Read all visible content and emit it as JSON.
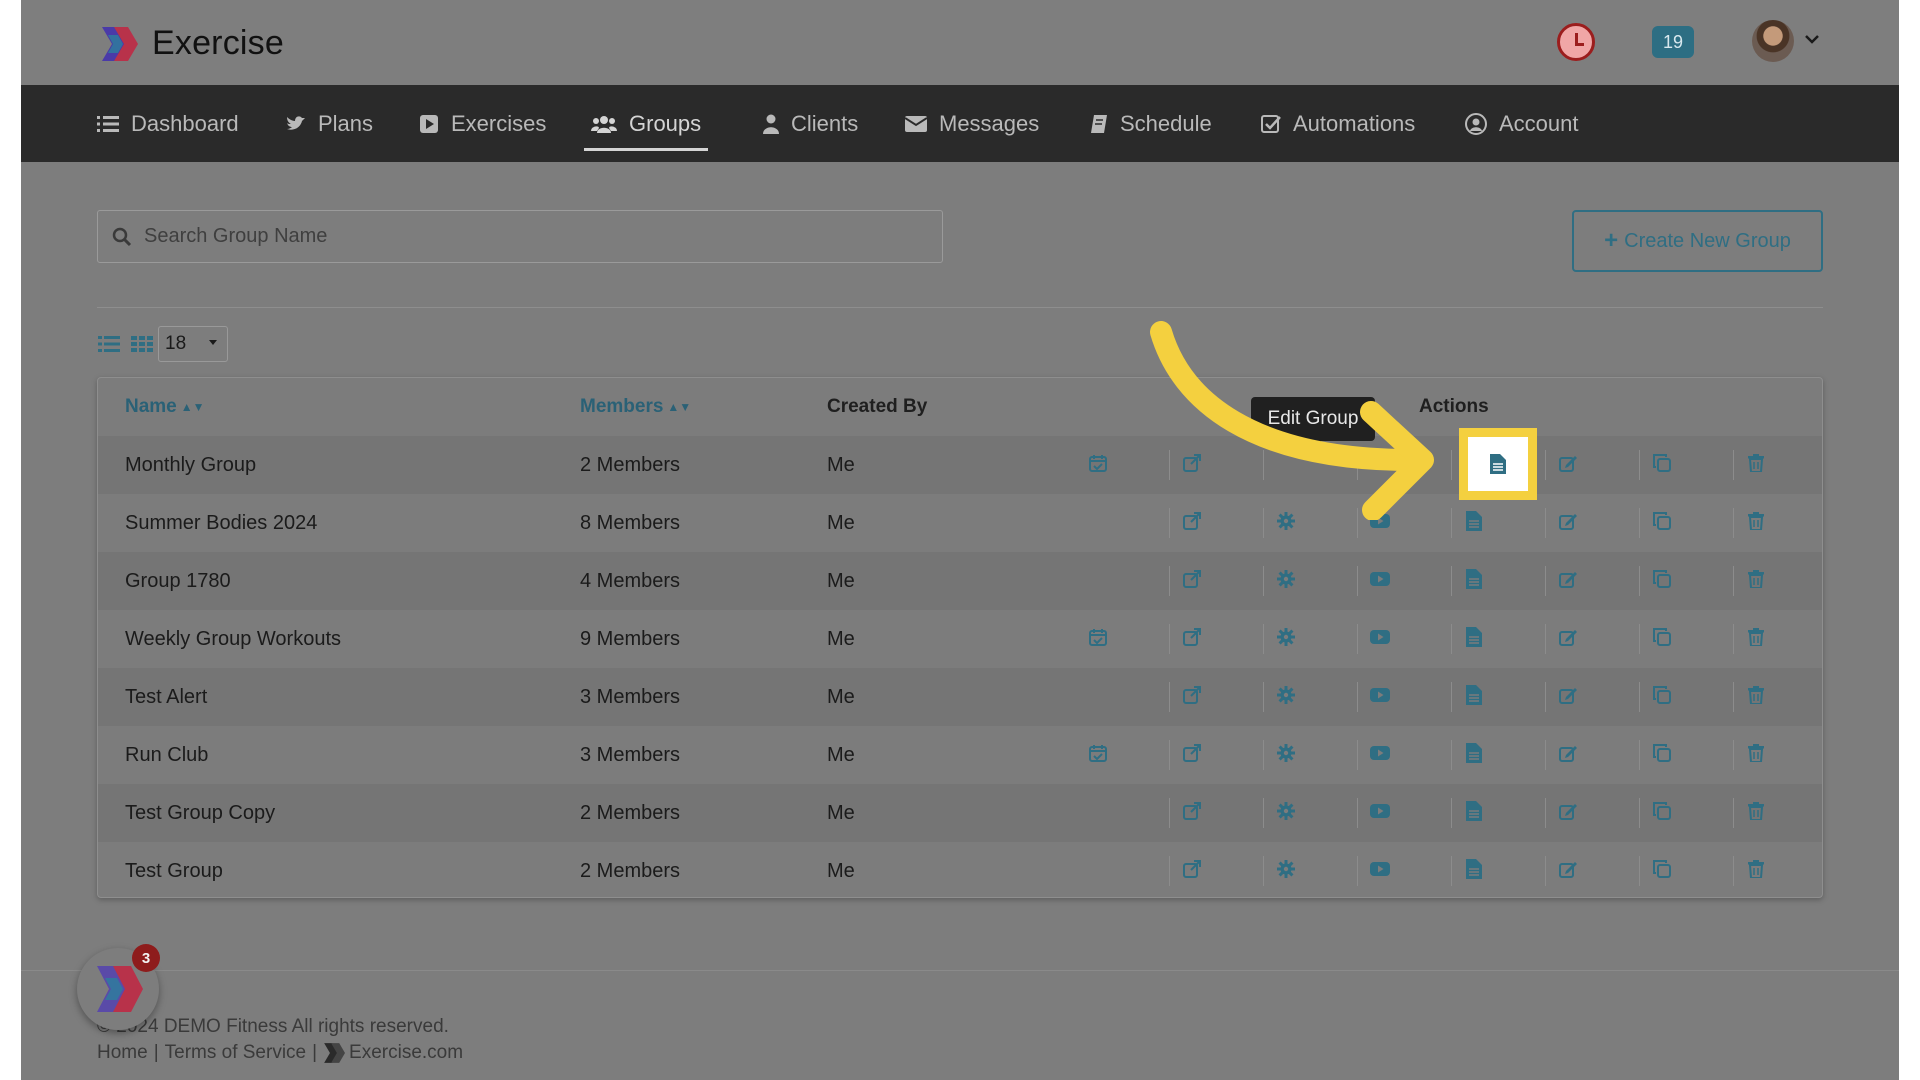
{
  "app": {
    "brand": "Exercise",
    "notification_count": "19"
  },
  "nav": {
    "items": [
      {
        "label": "Dashboard",
        "icon": "list-icon"
      },
      {
        "label": "Plans",
        "icon": "bird-icon"
      },
      {
        "label": "Exercises",
        "icon": "video-icon"
      },
      {
        "label": "Groups",
        "icon": "users-icon",
        "active": true
      },
      {
        "label": "Clients",
        "icon": "user-icon"
      },
      {
        "label": "Messages",
        "icon": "envelope-icon"
      },
      {
        "label": "Schedule",
        "icon": "book-icon"
      },
      {
        "label": "Automations",
        "icon": "check-square-icon"
      },
      {
        "label": "Account",
        "icon": "user-circle-icon"
      }
    ]
  },
  "search": {
    "placeholder": "Search Group Name",
    "value": ""
  },
  "toolbar": {
    "create_label": "Create New Group",
    "per_page": "18"
  },
  "table": {
    "headers": {
      "name": "Name",
      "members": "Members",
      "created_by": "Created By",
      "actions": "Actions"
    },
    "rows": [
      {
        "name": "Monthly Group",
        "members": "2 Members",
        "created_by": "Me",
        "has_calendar": true
      },
      {
        "name": "Summer Bodies 2024",
        "members": "8 Members",
        "created_by": "Me",
        "has_calendar": false
      },
      {
        "name": "Group 1780",
        "members": "4 Members",
        "created_by": "Me",
        "has_calendar": false
      },
      {
        "name": "Weekly Group Workouts",
        "members": "9 Members",
        "created_by": "Me",
        "has_calendar": true
      },
      {
        "name": "Test Alert",
        "members": "3 Members",
        "created_by": "Me",
        "has_calendar": false
      },
      {
        "name": "Run Club",
        "members": "3 Members",
        "created_by": "Me",
        "has_calendar": true
      },
      {
        "name": "Test Group Copy",
        "members": "2 Members",
        "created_by": "Me",
        "has_calendar": false
      },
      {
        "name": "Test Group",
        "members": "2 Members",
        "created_by": "Me",
        "has_calendar": false
      }
    ]
  },
  "tooltip": {
    "text": "Edit Group"
  },
  "footer": {
    "copyright": "© 2024 DEMO Fitness All rights reserved.",
    "home": "Home",
    "terms": "Terms of Service",
    "site": "Exercise.com",
    "separator": "|"
  },
  "chat": {
    "unread": "3"
  },
  "colors": {
    "accent": "#2f6e83",
    "highlight": "#f4d03f",
    "nav_bg": "#2a2a2a",
    "badge_red": "#8e1c1c"
  }
}
